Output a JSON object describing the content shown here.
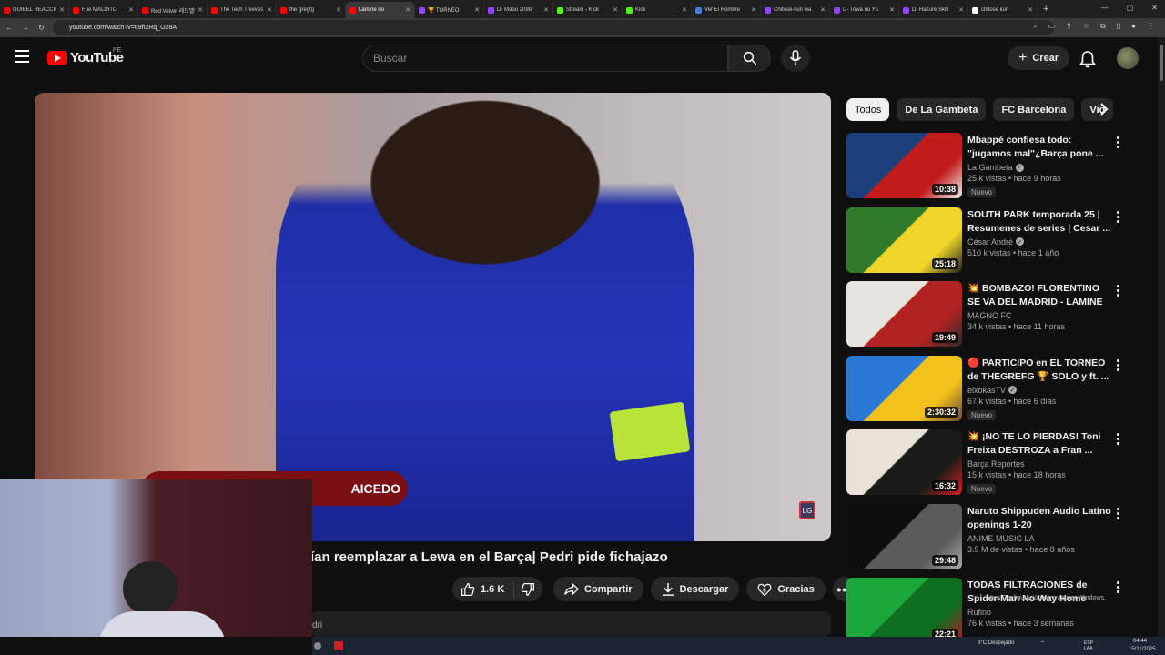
{
  "browser": {
    "tabs": [
      {
        "title": "GUIBEL REACCIONA",
        "color": "#ff0000"
      },
      {
        "title": "Fue MALDITO",
        "color": "#ff0000"
      },
      {
        "title": "Red Velvet 레드벨벳",
        "color": "#ff0000"
      },
      {
        "title": "The Tech Thieves",
        "color": "#ff0000"
      },
      {
        "title": "the gregfg",
        "color": "#ff0000"
      },
      {
        "title": "Lamine no",
        "color": "#ff0000",
        "active": true
      },
      {
        "title": "🏆 TORNEO",
        "color": "#9146ff"
      },
      {
        "title": "D- Maou 2099",
        "color": "#9146ff"
      },
      {
        "title": "Stream - Kick",
        "color": "#53fc18"
      },
      {
        "title": "Kick",
        "color": "#53fc18"
      },
      {
        "title": "Ver El Hombre",
        "color": "#4a7bd4"
      },
      {
        "title": "Chitose-kun wa",
        "color": "#9146ff"
      },
      {
        "title": "D- Towa no Yu",
        "color": "#9146ff"
      },
      {
        "title": "D- Hazure Skill",
        "color": "#9146ff"
      },
      {
        "title": "chitose kun",
        "color": "#ffffff"
      }
    ],
    "new_tab": "+",
    "url": "youtube.com/watch?v=69h2Rq_O28A"
  },
  "header": {
    "logo_text": "YouTube",
    "country_code": "PE",
    "search_placeholder": "Buscar",
    "create_label": "Crear"
  },
  "video": {
    "overlay_name": "AICEDO",
    "title": "ían reemplazar a Lewa en el Barça| Pedri pide fichajazo",
    "likes": "1.6 K",
    "share_label": "Compartir",
    "download_label": "Descargar",
    "thanks_label": "Gracias",
    "description_snippet": "dri"
  },
  "chips": [
    "Todos",
    "De La Gambeta",
    "FC Barcelona",
    "Vid"
  ],
  "recommendations": [
    {
      "title": "Mbappé confiesa todo: \"jugamos mal\"¿Barça pone ...",
      "channel": "La Gambeta",
      "verified": true,
      "stats": "25 k vistas • hace 9 horas",
      "badge": "Nuevo",
      "duration": "10:38",
      "thumb_colors": [
        "#1b3f7a",
        "#c21b1b",
        "#f1f1f1"
      ]
    },
    {
      "title": "SOUTH PARK temporada 25 | Resumenes de series | Cesar ...",
      "channel": "César André",
      "verified": true,
      "stats": "510 k vistas • hace 1 año",
      "badge": "",
      "duration": "25:18",
      "thumb_colors": [
        "#2f7a2a",
        "#f0d52a",
        "#1f1f1f"
      ]
    },
    {
      "title": "💥 BOMBAZO! FLORENTINO SE VA DEL MADRID - LAMINE ...",
      "channel": "MAGNO FC",
      "verified": false,
      "stats": "34 k vistas • hace 11 horas",
      "badge": "",
      "duration": "19:49",
      "thumb_colors": [
        "#e7e4e0",
        "#b12222",
        "#2a2a2a"
      ]
    },
    {
      "title": "🔴 PARTICIPO en EL TORNEO de THEGREFG 🏆 SOLO y ft. ...",
      "channel": "elxokasTV",
      "verified": true,
      "stats": "67 k vistas • hace 6 días",
      "badge": "Nuevo",
      "duration": "2:30:32",
      "thumb_colors": [
        "#2a78d6",
        "#f2c21a",
        "#6a4a3a"
      ]
    },
    {
      "title": "💥 ¡NO TE LO PIERDAS! Toni Freixa DESTROZA a Fran ...",
      "channel": "Barça Reportes",
      "verified": false,
      "stats": "15 k vistas • hace 18 horas",
      "badge": "Nuevo",
      "duration": "16:32",
      "thumb_colors": [
        "#e9e2d6",
        "#1a1a1a",
        "#d42020"
      ]
    },
    {
      "title": "Naruto Shippuden Audio Latino openings 1-20",
      "channel": "ANIME MUSIC LA",
      "verified": false,
      "stats": "3.9 M de vistas • hace 8 años",
      "badge": "",
      "duration": "29:48",
      "thumb_colors": [
        "#0d0d0d",
        "#5a5a5a",
        "#aaaaaa"
      ]
    },
    {
      "title": "TODAS FILTRACIONES de Spider-Man No Way Home que...",
      "channel": "Rufino",
      "verified": false,
      "stats": "76 k vistas • hace 3 semanas",
      "badge": "",
      "duration": "22:21",
      "thumb_colors": [
        "#1aa83a",
        "#0d6e1f",
        "#b7161f"
      ]
    }
  ],
  "system": {
    "activate_windows": "Ve a Configuración para activar Windows.",
    "weather": "8°C Despejado",
    "lang": "ESP LAA",
    "time": "04:44",
    "date": "15/11/2025"
  }
}
